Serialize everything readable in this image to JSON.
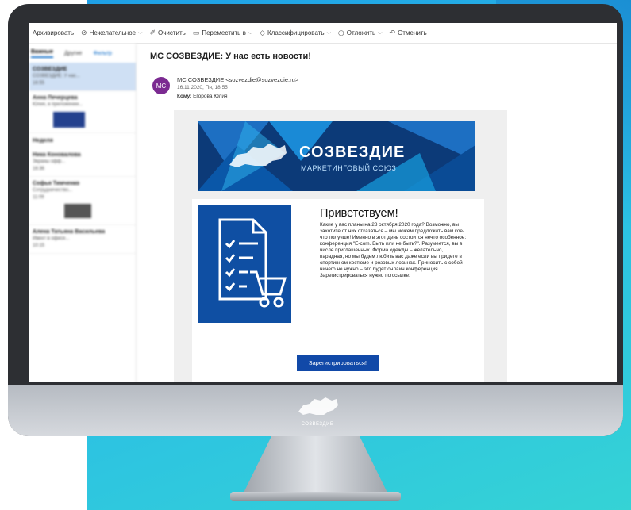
{
  "colors": {
    "background_accent": "#2bc0e4",
    "monitor_frame": "#2d2f33",
    "banner_blue": "#0c3a78",
    "button_blue": "#1149a8",
    "avatar_purple": "#7b2a91",
    "selected_row": "#cfe0f4"
  },
  "toolbar": {
    "items": [
      {
        "label": "Архивировать",
        "icon": "archive-icon"
      },
      {
        "label": "Нежелательное",
        "icon": "block-icon"
      },
      {
        "label": "Очистить",
        "icon": "sweep-icon"
      },
      {
        "label": "Переместить в",
        "icon": "move-icon"
      },
      {
        "label": "Классифицировать",
        "icon": "tag-icon"
      },
      {
        "label": "Отложить",
        "icon": "clock-icon"
      },
      {
        "label": "Отменить",
        "icon": "undo-icon"
      }
    ],
    "more": "···"
  },
  "message_list": {
    "tabs": [
      "Важные",
      "Другие"
    ],
    "filter_label": "Фильтр",
    "items": [
      {
        "from": "СОЗВЕЗДИЕ",
        "subject": "СОЗВЕЗДИЕ: У нас...",
        "time": "16:55"
      },
      {
        "from": "Анна Печерцева",
        "subject": "Юлия, в приложении..."
      },
      {
        "from": "Ника Коновалова",
        "subject": "Экраны офф...",
        "time": "16:36"
      },
      {
        "from": "Софья Тимченко",
        "subject": "Сотрудничество...",
        "time": "11:08"
      },
      {
        "from": "Алена Татьяна Васильева",
        "subject": "Ивент в офисе...",
        "time": "10:15"
      }
    ],
    "section_label": "Неделя"
  },
  "message": {
    "subject": "МС СОЗВЕЗДИЕ: У нас есть новости!",
    "avatar_initials": "МС",
    "sender": "МС СОЗВЕЗДИЕ <sozvezdie@sozvezdie.ru>",
    "date": "16.11.2020, Пн, 18:55",
    "to_label": "Кому:",
    "to_name": "Егорова Юлия"
  },
  "email": {
    "banner_title": "СОЗВЕЗДИЕ",
    "banner_subtitle": "МАРКЕТИНГОВЫЙ СОЮЗ",
    "greeting": "Приветствуем!",
    "body": "Какие у вас планы на 28 октября 2020 года? Возможно, вы захотите от них отказаться – мы можем предложить вам кое-что получше! Именно в этот день состоится нечто особенное: конференция \"E-com. Быть или не быть?\". Разумеется, вы в числе приглашенных. Форма одежды – желательно, парадная, но мы будем любить вас даже если вы придете в спортивном костюме и розовых лосинах. Приносить с собой ничего не нужно – это будет онлайн конференция. Зарегистрироваться нужно по ссылке:",
    "register_button": "Зарегистрироваться!"
  },
  "monitor": {
    "chin_logo_text": "СОЗВЕЗДИЕ"
  }
}
